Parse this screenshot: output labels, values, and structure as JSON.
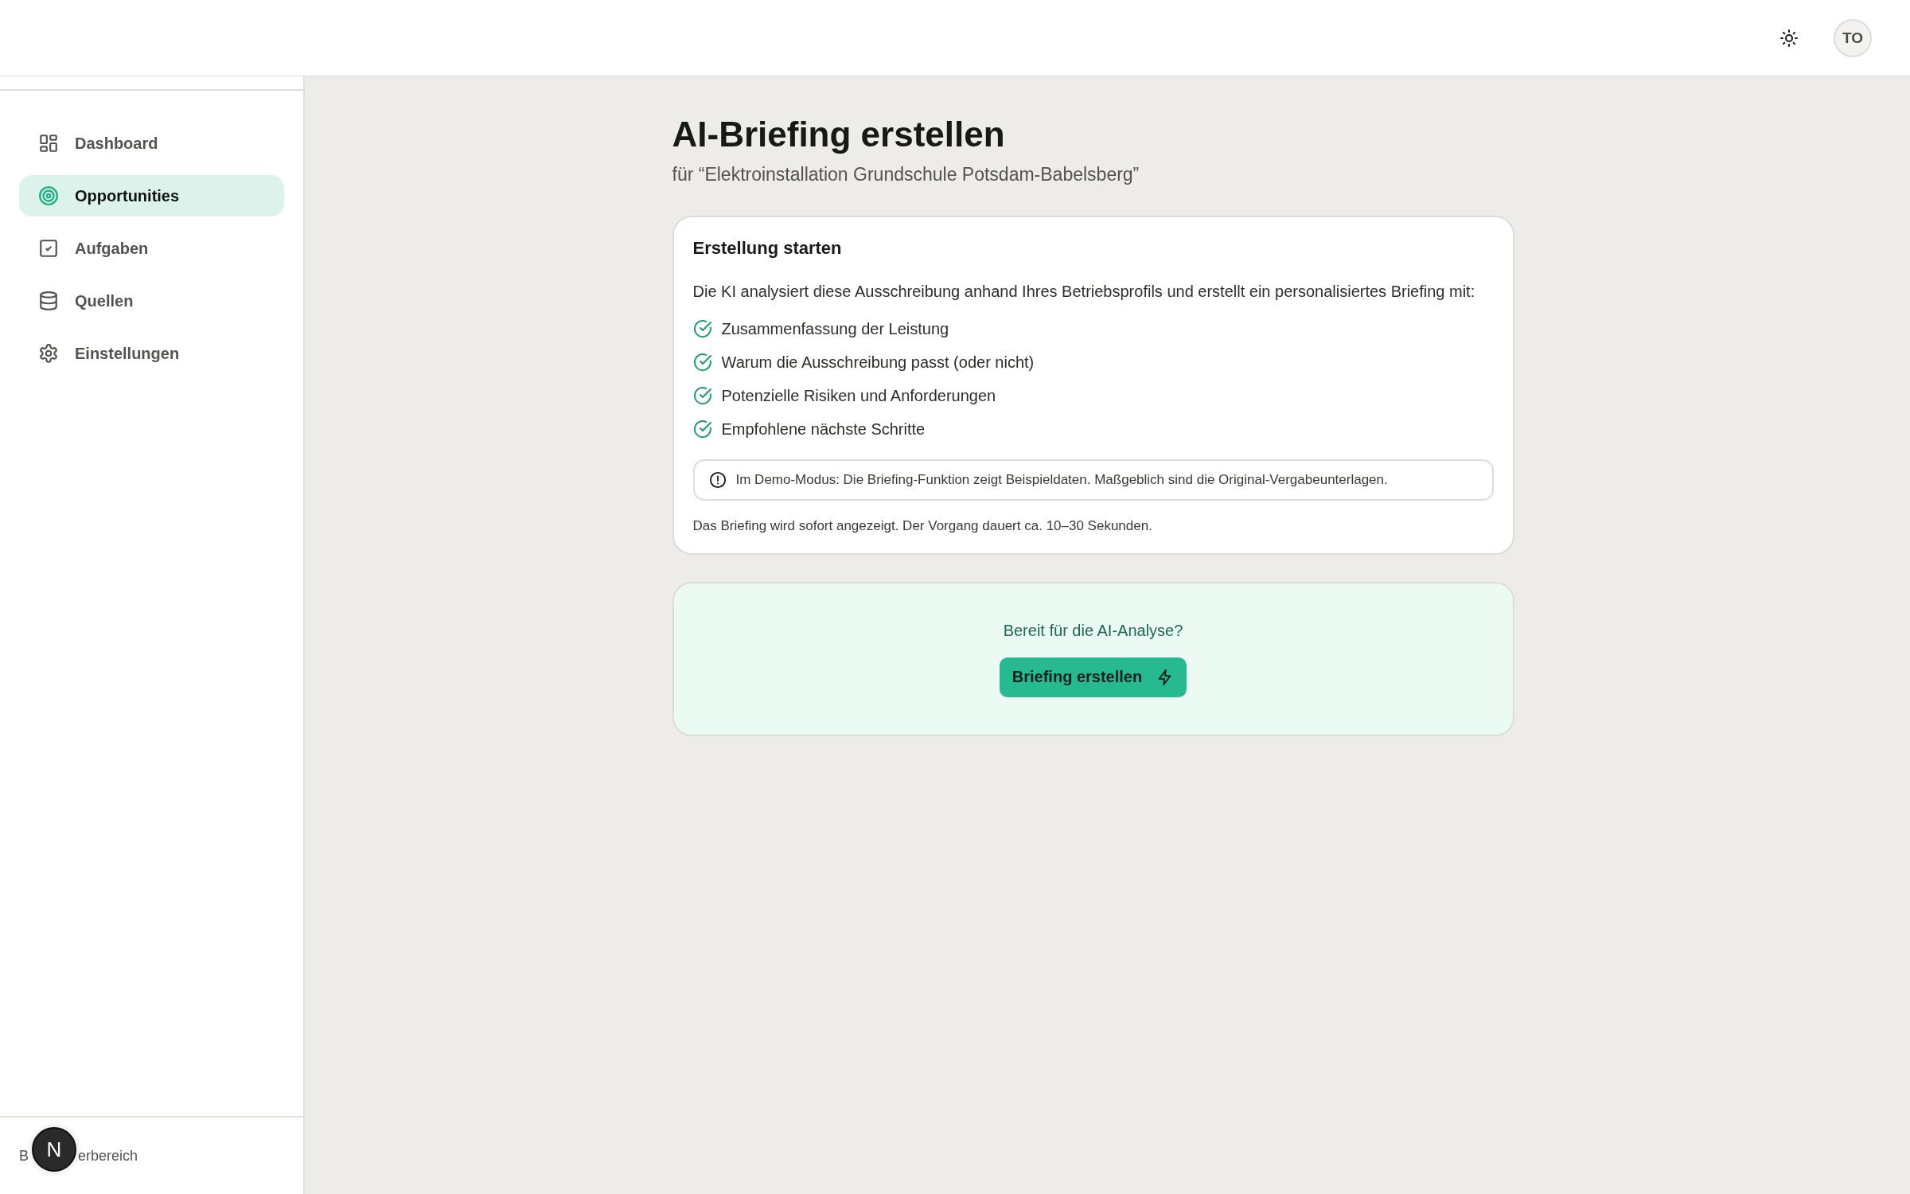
{
  "header": {
    "avatar": "TO"
  },
  "sidebar": {
    "items": [
      {
        "label": "Dashboard",
        "selected": false
      },
      {
        "label": "Opportunities",
        "selected": true
      },
      {
        "label": "Aufgaben",
        "selected": false
      },
      {
        "label": "Quellen",
        "selected": false
      },
      {
        "label": "Einstellungen",
        "selected": false
      }
    ],
    "footer": [
      "B",
      "erbereich"
    ],
    "dev_badge": "N"
  },
  "page": {
    "title": "AI-Briefing erstellen",
    "subtitle": "für “Elektroinstallation Grundschule Potsdam-Babelsberg”"
  },
  "card": {
    "title": "Erstellung starten",
    "intro": "Die KI analysiert diese Ausschreibung anhand Ihres Betriebsprofils und erstellt ein personalisiertes Briefing mit:",
    "features": [
      "Zusammenfassung der Leistung",
      "Warum die Ausschreibung passt (oder nicht)",
      "Potenzielle Risiken und Anforderungen",
      "Empfohlene nächste Schritte"
    ],
    "notice": "Im Demo-Modus: Die Briefing-Funktion zeigt Beispieldaten. Maßgeblich sind die Original-Vergabeunterlagen.",
    "note": "Das Briefing wird sofort angezeigt. Der Vorgang dauert ca. 10–30 Sekunden."
  },
  "cta": {
    "question": "Bereit für die AI-Analyse?",
    "button": "Briefing erstellen"
  }
}
